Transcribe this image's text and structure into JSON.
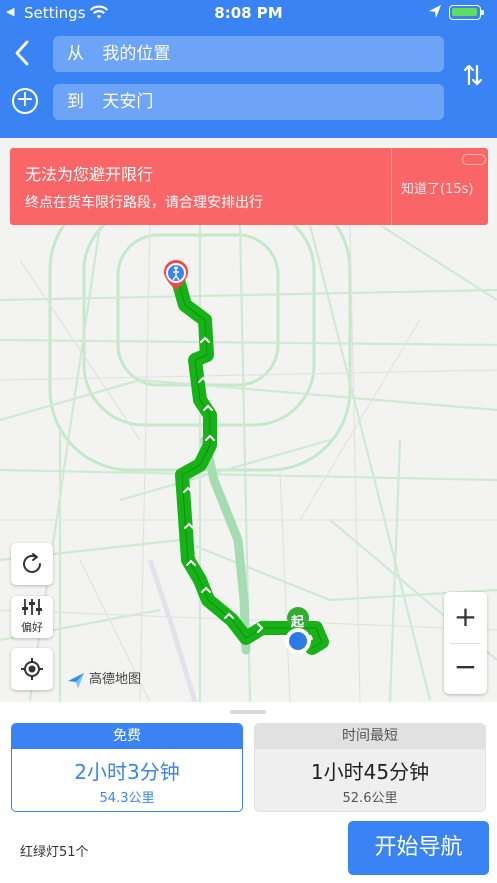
{
  "status_bar": {
    "back_app": "Settings",
    "time": "8:08 PM"
  },
  "header": {
    "from_prefix": "从",
    "from_value": "我的位置",
    "to_prefix": "到",
    "to_value": "天安门"
  },
  "alert": {
    "title": "无法为您避开限行",
    "message": "终点在货车限行路段，请合理安排出行",
    "dismiss": "知道了(15s)",
    "color": "#fa6667"
  },
  "map": {
    "start_marker": "起",
    "prefer_label": "偏好",
    "logo_text": "高德地图",
    "route_color": "#17b217",
    "alt_route_color": "#a6dcb2"
  },
  "routes": [
    {
      "tag": "免费",
      "duration": "2小时3分钟",
      "distance": "54.3公里",
      "selected": true
    },
    {
      "tag": "时间最短",
      "duration": "1小时45分钟",
      "distance": "52.6公里",
      "selected": false
    }
  ],
  "footer": {
    "traffic_lights": "红绿灯51个",
    "start_button": "开始导航"
  },
  "colors": {
    "brand_blue": "#3a83f5"
  }
}
